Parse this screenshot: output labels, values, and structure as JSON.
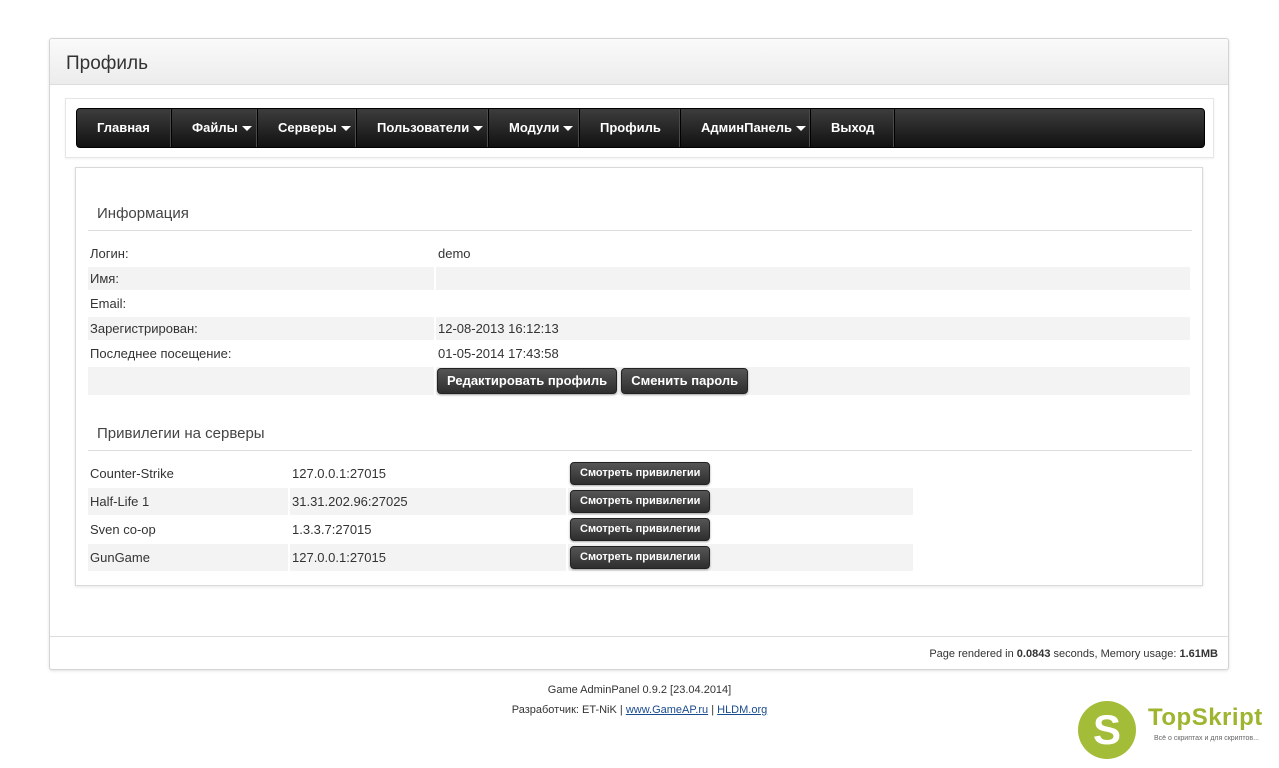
{
  "panel": {
    "title": "Профиль"
  },
  "nav": {
    "items": [
      {
        "label": "Главная",
        "dropdown": false,
        "width": 95
      },
      {
        "label": "Файлы",
        "dropdown": true,
        "width": 86
      },
      {
        "label": "Серверы",
        "dropdown": true,
        "width": 99
      },
      {
        "label": "Пользователи",
        "dropdown": true,
        "width": 132
      },
      {
        "label": "Модули",
        "dropdown": true,
        "width": 91
      },
      {
        "label": "Профиль",
        "dropdown": false,
        "width": 101
      },
      {
        "label": "АдминПанель",
        "dropdown": true,
        "width": 130
      },
      {
        "label": "Выход",
        "dropdown": false,
        "width": 84
      }
    ]
  },
  "info": {
    "title": "Информация",
    "rows": [
      {
        "label": "Логин:",
        "value": "demo"
      },
      {
        "label": "Имя:",
        "value": ""
      },
      {
        "label": "Email:",
        "value": ""
      },
      {
        "label": "Зарегистрирован:",
        "value": "12-08-2013 16:12:13"
      },
      {
        "label": "Последнее посещение:",
        "value": "01-05-2014 17:43:58"
      }
    ],
    "edit_button": "Редактировать профиль",
    "password_button": "Сменить пароль"
  },
  "privileges": {
    "title": "Привилегии на серверы",
    "button_label": "Смотреть привилегии",
    "servers": [
      {
        "game": "Counter-Strike",
        "address": "127.0.0.1:27015"
      },
      {
        "game": "Half-Life 1",
        "address": "31.31.202.96:27025"
      },
      {
        "game": "Sven co-op",
        "address": "1.3.3.7:27015"
      },
      {
        "game": "GunGame",
        "address": "127.0.0.1:27015"
      }
    ]
  },
  "footer": {
    "render_prefix": "Page rendered in ",
    "render_time": "0.0843",
    "render_mid": " seconds, Memory usage: ",
    "memory": "1.61MB",
    "version": "Game AdminPanel 0.9.2 [23.04.2014]",
    "developer_prefix": "Разработчик: ET-NiK | ",
    "link1": "www.GameAP.ru",
    "sep": " | ",
    "link2": "HLDM.org"
  },
  "watermark": {
    "letter": "S",
    "name": "TopSkript",
    "tagline": "Всё о скриптах и для скриптов..."
  }
}
